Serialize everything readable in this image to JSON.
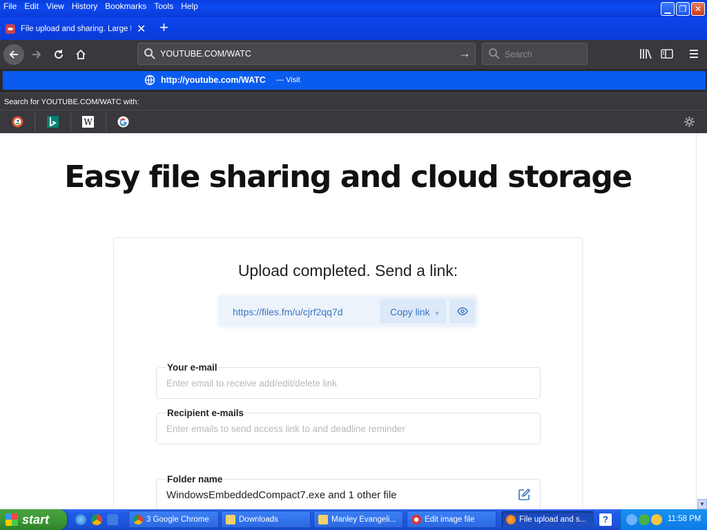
{
  "menu": {
    "items": [
      "File",
      "Edit",
      "View",
      "History",
      "Bookmarks",
      "Tools",
      "Help"
    ]
  },
  "window_controls": {
    "minimize": "minimize-icon",
    "restore": "restore-icon",
    "close": "close-icon"
  },
  "tab": {
    "title": "File upload and sharing. Large file",
    "close_glyph": "✕",
    "new_tab_glyph": "+"
  },
  "urlbar": {
    "text": "YOUTUBE.COM/WATC",
    "go_glyph": "→"
  },
  "searchbar": {
    "placeholder": "Search"
  },
  "suggestion": {
    "url": "http://youtube.com/WATC",
    "separator": "—",
    "action": "Visit"
  },
  "search_with": {
    "label": "Search for YOUTUBE.COM/WATC with:"
  },
  "engines": [
    "duckduckgo-icon",
    "bing-icon",
    "wikipedia-icon",
    "google-icon"
  ],
  "page": {
    "headline": "Easy file sharing and cloud storage",
    "upload_heading": "Upload completed. Send a link:",
    "share_link": "https://files.fm/u/cjrf2qq7d",
    "copy_link_label": "Copy link",
    "fields": {
      "email_label": "Your e-mail",
      "email_placeholder": "Enter email to receive add/edit/delete link",
      "recipient_label": "Recipient e-mails",
      "recipient_placeholder": "Enter emails to send access link to and deadline reminder",
      "folder_label": "Folder name",
      "folder_value": "WindowsEmbeddedCompact7.exe and 1 other file"
    }
  },
  "taskbar": {
    "start_label": "start",
    "buttons": [
      "3 Google Chrome",
      "Downloads",
      "Manley Evangeli...",
      "Edit image file",
      "File upload and s..."
    ],
    "clock": "11:58 PM"
  },
  "colors": {
    "accent": "#0a5cf0",
    "link": "#3a73c4",
    "titlebar": "#0c48f0",
    "toolbar": "#38383d"
  }
}
